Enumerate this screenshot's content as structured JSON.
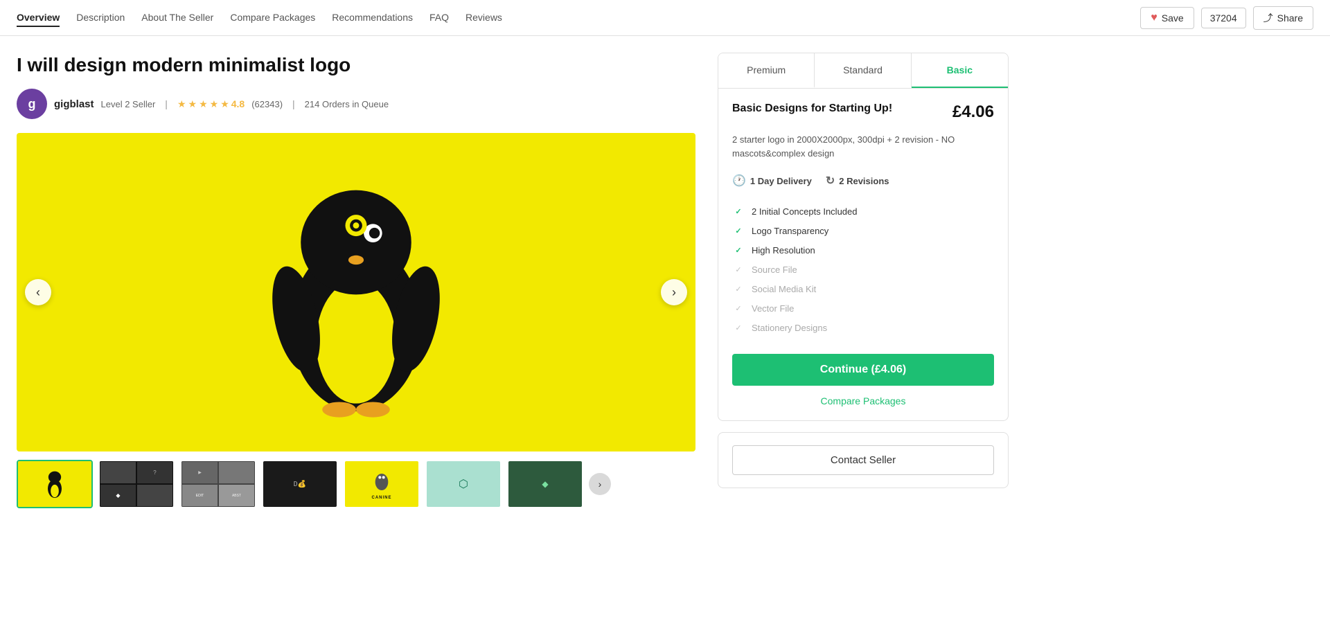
{
  "nav": {
    "links": [
      {
        "label": "Overview",
        "active": true
      },
      {
        "label": "Description",
        "active": false
      },
      {
        "label": "About The Seller",
        "active": false
      },
      {
        "label": "Compare Packages",
        "active": false
      },
      {
        "label": "Recommendations",
        "active": false
      },
      {
        "label": "FAQ",
        "active": false
      },
      {
        "label": "Reviews",
        "active": false
      }
    ],
    "save_label": "Save",
    "save_count": "37204",
    "share_label": "Share"
  },
  "gig": {
    "title": "I will design modern minimalist logo",
    "seller": {
      "name": "gigblast",
      "level": "Level 2 Seller",
      "rating": "4.8",
      "review_count": "(62343)",
      "orders_queue": "214 Orders in Queue"
    }
  },
  "packages": {
    "tabs": [
      {
        "label": "Premium",
        "active": false
      },
      {
        "label": "Standard",
        "active": false
      },
      {
        "label": "Basic",
        "active": true
      }
    ],
    "active": {
      "name": "Basic Designs for Starting Up!",
      "price": "£4.06",
      "description": "2 starter logo in 2000X2000px, 300dpi + 2 revision - NO mascots&complex design",
      "delivery": "1 Day Delivery",
      "revisions": "2 Revisions",
      "features": [
        {
          "label": "2 Initial Concepts Included",
          "enabled": true
        },
        {
          "label": "Logo Transparency",
          "enabled": true
        },
        {
          "label": "High Resolution",
          "enabled": true
        },
        {
          "label": "Source File",
          "enabled": false
        },
        {
          "label": "Social Media Kit",
          "enabled": false
        },
        {
          "label": "Vector File",
          "enabled": false
        },
        {
          "label": "Stationery Designs",
          "enabled": false
        }
      ],
      "continue_label": "Continue (£4.06)",
      "compare_label": "Compare Packages"
    }
  },
  "contact": {
    "label": "Contact Seller"
  },
  "thumbnails": [
    {
      "bg": "yellow",
      "active": true
    },
    {
      "bg": "grid-dark",
      "active": false
    },
    {
      "bg": "grid-dark2",
      "active": false
    },
    {
      "bg": "grid-dark3",
      "active": false
    },
    {
      "bg": "dark-logo",
      "active": false
    },
    {
      "bg": "yellow2",
      "active": false
    },
    {
      "bg": "teal",
      "active": false
    },
    {
      "bg": "green",
      "active": false
    }
  ],
  "colors": {
    "green": "#1dbf73",
    "star": "#f4b942",
    "accent": "#1dbf73"
  }
}
